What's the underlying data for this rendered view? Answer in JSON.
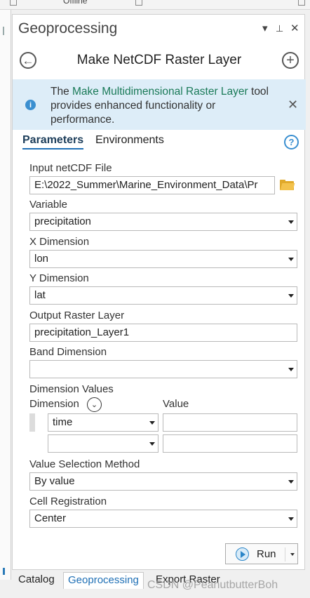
{
  "top_strip": {
    "label": "Offline"
  },
  "pane": {
    "title": "Geoprocessing",
    "menu_icon": "▾",
    "pin_icon": "📌",
    "close_icon": "✕"
  },
  "tool": {
    "title": "Make NetCDF Raster Layer",
    "back_icon": "←",
    "add_icon": "+"
  },
  "banner": {
    "text_before": "The ",
    "link": "Make Multidimensional Raster Layer",
    "text_after": " tool provides enhanced functionality or performance.",
    "close_icon": "✕"
  },
  "tabs": {
    "parameters": "Parameters",
    "environments": "Environments",
    "help_icon": "?"
  },
  "params": {
    "input_label": "Input netCDF File",
    "input_value": "E:\\2022_Summer\\Marine_Environment_Data\\Pr",
    "variable_label": "Variable",
    "variable_value": "precipitation",
    "x_label": "X Dimension",
    "x_value": "lon",
    "y_label": "Y Dimension",
    "y_value": "lat",
    "output_label": "Output Raster Layer",
    "output_value": "precipitation_Layer1",
    "band_label": "Band Dimension",
    "band_value": "",
    "dimvals_label": "Dimension Values",
    "dimension_col": "Dimension",
    "value_col": "Value",
    "rows": [
      {
        "dimension": "time",
        "value": ""
      },
      {
        "dimension": "",
        "value": ""
      }
    ],
    "method_label": "Value Selection Method",
    "method_value": "By value",
    "cellreg_label": "Cell Registration",
    "cellreg_value": "Center"
  },
  "run": {
    "label": "Run"
  },
  "bottom_tabs": {
    "catalog": "Catalog",
    "geoprocessing": "Geoprocessing",
    "export": "Export Raster"
  },
  "watermark": "CSDN @PeanutbutterBoh"
}
